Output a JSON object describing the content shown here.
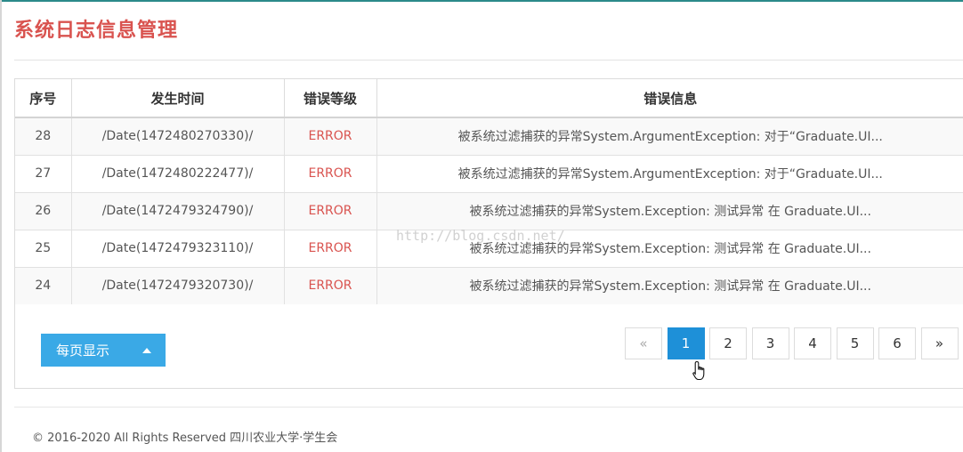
{
  "page": {
    "title": "系统日志信息管理"
  },
  "table": {
    "headers": [
      "序号",
      "发生时间",
      "错误等级",
      "错误信息"
    ],
    "rows": [
      [
        "28",
        "/Date(1472480270330)/",
        "ERROR",
        "被系统过滤捕获的异常System.ArgumentException: 对于“Graduate.UI..."
      ],
      [
        "27",
        "/Date(1472480222477)/",
        "ERROR",
        "被系统过滤捕获的异常System.ArgumentException: 对于“Graduate.UI..."
      ],
      [
        "26",
        "/Date(1472479324790)/",
        "ERROR",
        "被系统过滤捕获的异常System.Exception: 测试异常 在 Graduate.UI..."
      ],
      [
        "25",
        "/Date(1472479323110)/",
        "ERROR",
        "被系统过滤捕获的异常System.Exception: 测试异常 在 Graduate.UI..."
      ],
      [
        "24",
        "/Date(1472479320730)/",
        "ERROR",
        "被系统过滤捕获的异常System.Exception: 测试异常 在 Graduate.UI..."
      ]
    ]
  },
  "watermark": "http://blog.csdn.net/",
  "page_size": {
    "label": "每页显示",
    "icon": "caret-up-icon"
  },
  "pagination": {
    "prev": "«",
    "pages": [
      "1",
      "2",
      "3",
      "4",
      "5",
      "6"
    ],
    "active": "1",
    "next": "»"
  },
  "footer": {
    "copyright": "© 2016-2020 All Rights Reserved 四川农业大学·学生会"
  },
  "colors": {
    "title": "#d9534f",
    "error": "#d9534f",
    "button": "#3aa9e6",
    "active_page": "#1e90d8"
  }
}
